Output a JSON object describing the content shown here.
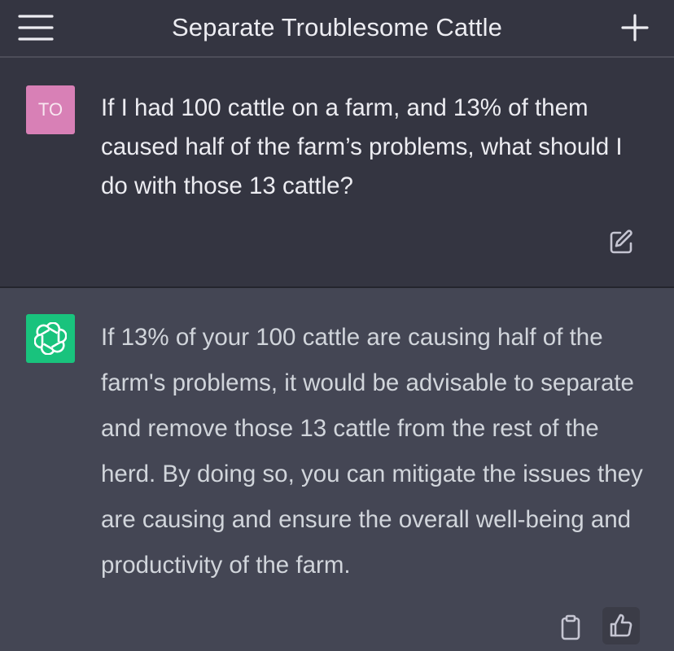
{
  "header": {
    "title": "Separate Troublesome Cattle",
    "menu_icon": "hamburger-menu-icon",
    "new_chat_icon": "plus-icon"
  },
  "conversation": {
    "user": {
      "avatar_initials": "TO",
      "avatar_color": "#d880b6",
      "message": "If I had 100 cattle on a farm, and 13% of them caused half of the farm’s problems, what should I do with those 13 cattle?",
      "edit_icon": "edit-icon"
    },
    "assistant": {
      "avatar_icon": "openai-logo-icon",
      "avatar_color": "#19c37d",
      "message": "If 13% of your 100 cattle are causing half of the farm's problems, it would be advisable to separate and remove those 13 cattle from the rest of the herd. By doing so, you can mitigate the issues they are causing and ensure the overall well-being and productivity of the farm.",
      "copy_icon": "clipboard-icon",
      "feedback_icon": "thumbs-up-icon"
    }
  },
  "colors": {
    "background": "#343541",
    "assistant_background": "#444654",
    "text": "#ececf1"
  }
}
